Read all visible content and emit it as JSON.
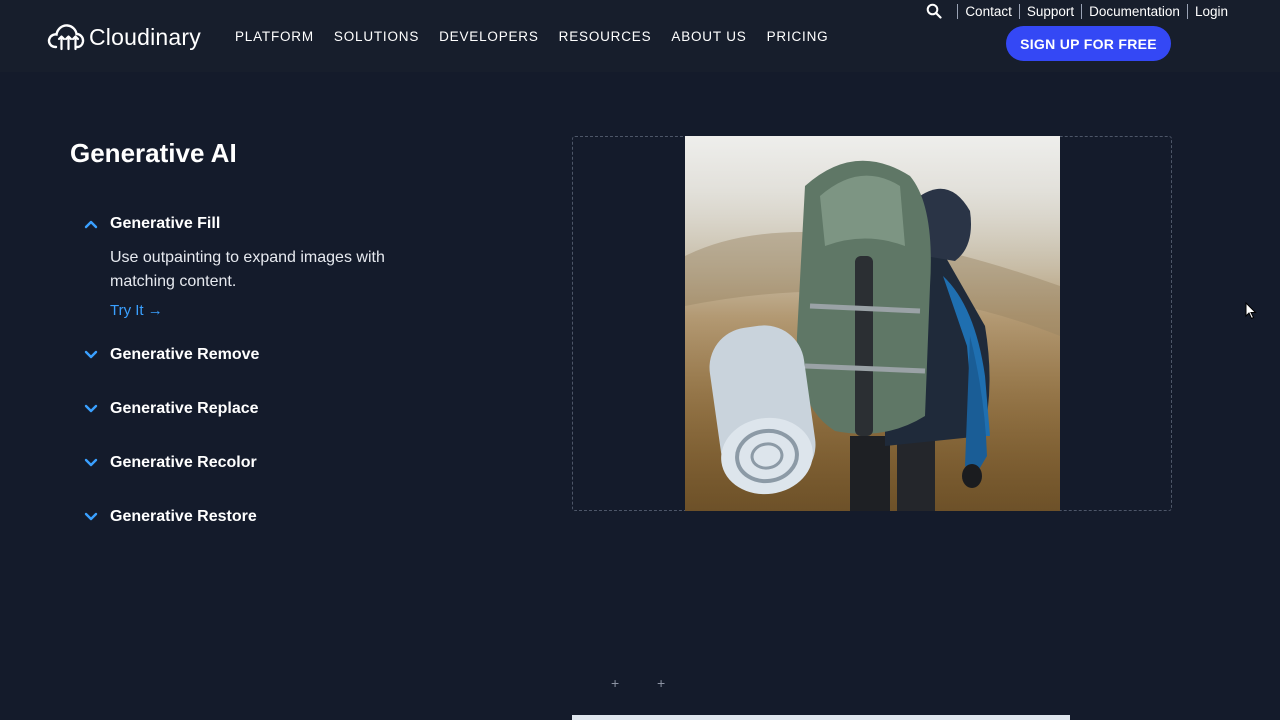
{
  "header": {
    "logo_text": "Cloudinary",
    "nav": [
      "PLATFORM",
      "SOLUTIONS",
      "DEVELOPERS",
      "RESOURCES",
      "ABOUT US",
      "PRICING"
    ],
    "utility_links": [
      "Contact",
      "Support",
      "Documentation",
      "Login"
    ],
    "signup_label": "SIGN UP FOR FREE"
  },
  "section": {
    "title": "Generative AI",
    "items": [
      {
        "label": "Generative Fill",
        "expanded": true
      },
      {
        "label": "Generative Remove",
        "expanded": false
      },
      {
        "label": "Generative Replace",
        "expanded": false
      },
      {
        "label": "Generative Recolor",
        "expanded": false
      },
      {
        "label": "Generative Restore",
        "expanded": false
      }
    ],
    "expanded_description": "Use outpainting to expand images with matching content.",
    "try_label": "Try It →"
  },
  "colors": {
    "background": "#141b2b",
    "header": "#171e2c",
    "accent_button": "#3448f5",
    "link": "#3aa0ff"
  },
  "icons": [
    "cloudinary-logo-icon",
    "search-icon",
    "chevron-up-icon",
    "chevron-down-icon",
    "plus-icon",
    "cursor-icon"
  ]
}
